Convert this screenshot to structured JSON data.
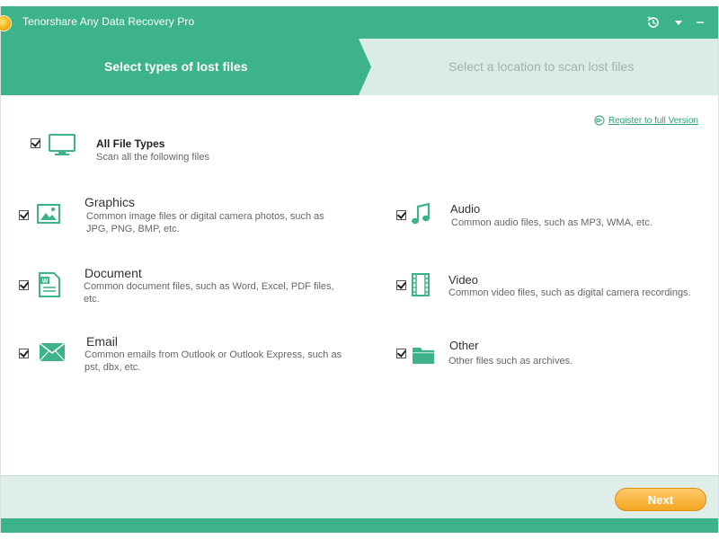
{
  "window": {
    "title": "Tenorshare Any Data Recovery Pro"
  },
  "colors": {
    "brand": "#3db38a",
    "accent_button": "#f5a623",
    "link": "#2f9e78"
  },
  "steps": [
    {
      "label": "Select types of lost files",
      "active": true
    },
    {
      "label": "Select a location to scan lost files",
      "active": false
    }
  ],
  "register_link": "Register to full Version",
  "all_types": {
    "title": "All File Types",
    "description": "Scan all the following files",
    "checked": true
  },
  "file_types": [
    {
      "title": "Graphics",
      "description": "Common image files or digital camera photos, such as JPG, PNG, BMP, etc.",
      "icon": "image-icon",
      "checked": true
    },
    {
      "title": "Audio",
      "description": "Common audio files, such as MP3, WMA, etc.",
      "icon": "music-note-icon",
      "checked": true
    },
    {
      "title": "Document",
      "description": "Common document files, such as Word, Excel, PDF files, etc.",
      "icon": "document-icon",
      "checked": true
    },
    {
      "title": "Video",
      "description": "Common video files, such as digital camera recordings.",
      "icon": "film-icon",
      "checked": true
    },
    {
      "title": "Email",
      "description": "Common emails from Outlook or Outlook Express, such as pst, dbx, etc.",
      "icon": "envelope-icon",
      "checked": true
    },
    {
      "title": "Other",
      "description": "Other files such as archives.",
      "icon": "folder-icon",
      "checked": true
    }
  ],
  "next_button": "Next"
}
